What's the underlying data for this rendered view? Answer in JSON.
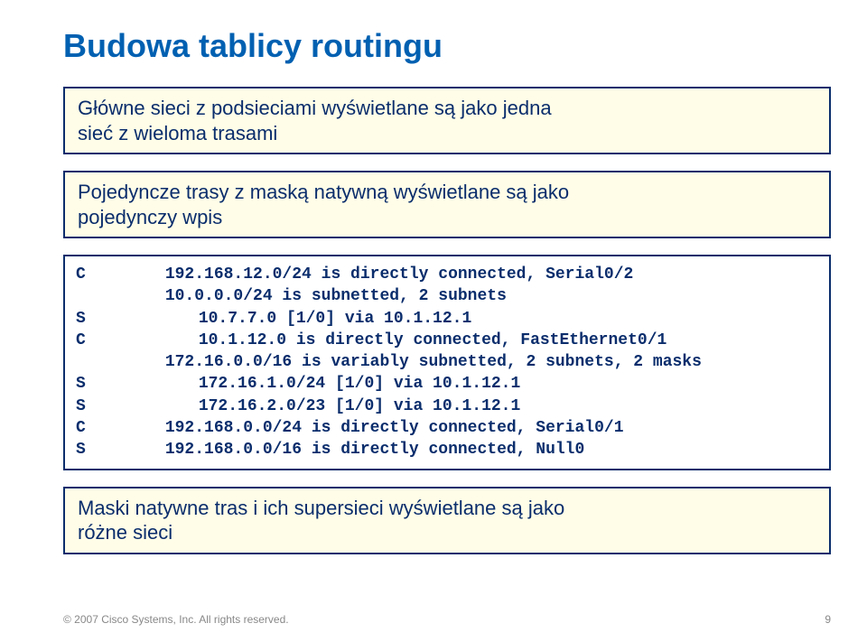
{
  "title": "Budowa tablicy routingu",
  "callout1": {
    "line1": "Główne sieci z podsieciami wyświetlane są jako jedna",
    "line2": "sieć z wieloma trasami"
  },
  "callout2": {
    "line1": "Pojedyncze trasy z maską natywną wyświetlane są jako",
    "line2": "pojedynczy wpis"
  },
  "routes": {
    "r0_flag": "C",
    "r0_text": "192.168.12.0/24 is directly connected, Serial0/2",
    "r1_text": "10.0.0.0/24 is subnetted, 2 subnets",
    "r2_flag": "S",
    "r2_text": "10.7.7.0 [1/0] via 10.1.12.1",
    "r3_flag": "C",
    "r3_text": "10.1.12.0 is directly connected, FastEthernet0/1",
    "r4_text": "172.16.0.0/16 is variably subnetted, 2 subnets, 2 masks",
    "r5_flag": "S",
    "r5_text": "172.16.1.0/24 [1/0] via 10.1.12.1",
    "r6_flag": "S",
    "r6_text": "172.16.2.0/23 [1/0] via 10.1.12.1",
    "r7_flag": "C",
    "r7_text": "192.168.0.0/24 is directly connected, Serial0/1",
    "r8_flag": "S",
    "r8_text": "192.168.0.0/16 is directly connected, Null0"
  },
  "callout3": {
    "line1": "Maski natywne tras i ich supersieci wyświetlane są jako",
    "line2": "różne sieci"
  },
  "footer": {
    "left": "© 2007 Cisco Systems, Inc. All rights reserved.",
    "right": "9"
  }
}
